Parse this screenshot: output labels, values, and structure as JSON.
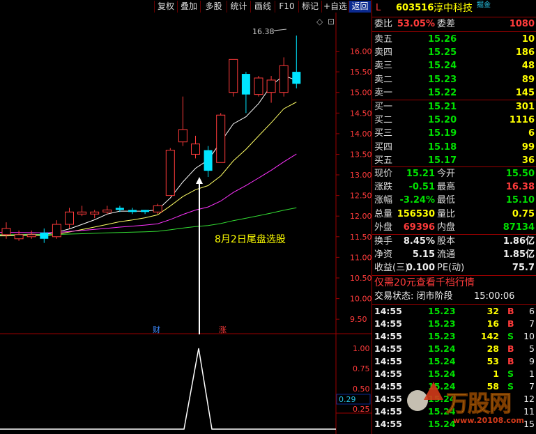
{
  "toolbar": {
    "buttons": [
      "复权",
      "叠加",
      "多股",
      "统计",
      "画线",
      "F10",
      "标记",
      "+自选",
      "返回"
    ]
  },
  "stock": {
    "flag": "L",
    "code": "603516",
    "name": "淳中科技",
    "badge": "掘金"
  },
  "order": {
    "weibi_label": "委比",
    "weibi_value": "53.05%",
    "weicha_label": "委差",
    "weicha_value": "1080",
    "asks": [
      {
        "label": "卖五",
        "price": "15.26",
        "vol": "10"
      },
      {
        "label": "卖四",
        "price": "15.25",
        "vol": "186"
      },
      {
        "label": "卖三",
        "price": "15.24",
        "vol": "48"
      },
      {
        "label": "卖二",
        "price": "15.23",
        "vol": "89"
      },
      {
        "label": "卖一",
        "price": "15.22",
        "vol": "145"
      }
    ],
    "bids": [
      {
        "label": "买一",
        "price": "15.21",
        "vol": "301"
      },
      {
        "label": "买二",
        "price": "15.20",
        "vol": "1116"
      },
      {
        "label": "买三",
        "price": "15.19",
        "vol": "6"
      },
      {
        "label": "买四",
        "price": "15.18",
        "vol": "99"
      },
      {
        "label": "买五",
        "price": "15.17",
        "vol": "36"
      }
    ]
  },
  "quote": {
    "rows": [
      {
        "l1": "现价",
        "v1": "15.21",
        "c1": "green",
        "l2": "今开",
        "v2": "15.50",
        "c2": "green"
      },
      {
        "l1": "涨跌",
        "v1": "-0.51",
        "c1": "green",
        "l2": "最高",
        "v2": "16.38",
        "c2": "red"
      },
      {
        "l1": "涨幅",
        "v1": "-3.24%",
        "c1": "green",
        "l2": "最低",
        "v2": "15.10",
        "c2": "green"
      },
      {
        "l1": "总量",
        "v1": "156530",
        "c1": "yel",
        "l2": "量比",
        "v2": "0.75",
        "c2": "yel"
      },
      {
        "l1": "外盘",
        "v1": "69396",
        "c1": "red",
        "l2": "内盘",
        "v2": "87134",
        "c2": "green"
      }
    ]
  },
  "fin": {
    "rows": [
      {
        "l1": "换手",
        "v1": "8.45%",
        "l2": "股本",
        "v2": "1.86亿"
      },
      {
        "l1": "净资",
        "v1": "5.15",
        "l2": "流通",
        "v2": "1.85亿"
      },
      {
        "l1": "收益(三)",
        "v1": "0.100",
        "l2": "PE(动)",
        "v2": "75.7"
      }
    ]
  },
  "promo": "仅需20元查看千档行情",
  "trade_status": {
    "label": "交易状态: 闭市阶段",
    "time": "15:00:06"
  },
  "ticks": [
    {
      "t": "14:55",
      "p": "15.23",
      "v": "32",
      "d": "B",
      "n": "6"
    },
    {
      "t": "14:55",
      "p": "15.23",
      "v": "16",
      "d": "B",
      "n": "7"
    },
    {
      "t": "14:55",
      "p": "15.23",
      "v": "142",
      "d": "S",
      "n": "10"
    },
    {
      "t": "14:55",
      "p": "15.24",
      "v": "28",
      "d": "B",
      "n": "5"
    },
    {
      "t": "14:55",
      "p": "15.24",
      "v": "53",
      "d": "B",
      "n": "9"
    },
    {
      "t": "14:55",
      "p": "15.24",
      "v": "1",
      "d": "S",
      "n": "1"
    },
    {
      "t": "14:55",
      "p": "15.24",
      "v": "58",
      "d": "S",
      "n": "7"
    },
    {
      "t": "14:55",
      "p": "15.24",
      "v": "",
      "d": "",
      "n": "12"
    },
    {
      "t": "14:55",
      "p": "15.24",
      "v": "",
      "d": "",
      "n": "11"
    },
    {
      "t": "14:55",
      "p": "15.24",
      "v": "",
      "d": "",
      "n": "15"
    }
  ],
  "watermark": {
    "text": "万股网",
    "url": "www.20108.com"
  },
  "chart_data": {
    "type": "candlestick",
    "price_axis_ticks": [
      "16.00",
      "15.50",
      "15.00",
      "14.50",
      "14.00",
      "13.50",
      "13.00",
      "12.50",
      "12.00",
      "11.50",
      "11.00",
      "10.50",
      "10.00",
      "9.50"
    ],
    "ylim": [
      9.3,
      16.6
    ],
    "high_label": "16.38",
    "annotation": "8月2日尾盘选股",
    "event_labels": [
      "财",
      "涨"
    ],
    "candles": [
      {
        "o": 11.55,
        "c": 11.7,
        "h": 11.85,
        "l": 11.45
      },
      {
        "o": 11.45,
        "c": 11.55,
        "h": 11.65,
        "l": 11.4
      },
      {
        "o": 11.5,
        "c": 11.55,
        "h": 11.65,
        "l": 11.45
      },
      {
        "o": 11.6,
        "c": 11.45,
        "h": 11.7,
        "l": 11.35
      },
      {
        "o": 11.5,
        "c": 11.8,
        "h": 11.9,
        "l": 11.45
      },
      {
        "o": 11.8,
        "c": 12.1,
        "h": 12.2,
        "l": 11.7
      },
      {
        "o": 12.05,
        "c": 12.1,
        "h": 12.25,
        "l": 12.0
      },
      {
        "o": 12.05,
        "c": 12.1,
        "h": 12.15,
        "l": 11.95
      },
      {
        "o": 12.1,
        "c": 12.15,
        "h": 12.25,
        "l": 12.05
      },
      {
        "o": 12.2,
        "c": 12.15,
        "h": 12.25,
        "l": 12.1
      },
      {
        "o": 12.15,
        "c": 12.1,
        "h": 12.2,
        "l": 12.05
      },
      {
        "o": 12.15,
        "c": 12.1,
        "h": 12.15,
        "l": 12.05
      },
      {
        "o": 12.1,
        "c": 12.25,
        "h": 12.3,
        "l": 12.05
      },
      {
        "o": 12.5,
        "c": 13.6,
        "h": 13.65,
        "l": 12.5
      },
      {
        "o": 13.8,
        "c": 14.1,
        "h": 14.9,
        "l": 13.7
      },
      {
        "o": 13.5,
        "c": 13.75,
        "h": 13.95,
        "l": 13.4
      },
      {
        "o": 13.6,
        "c": 13.1,
        "h": 13.7,
        "l": 12.95
      },
      {
        "o": 13.3,
        "c": 14.45,
        "h": 14.5,
        "l": 13.3
      },
      {
        "o": 15.0,
        "c": 15.8,
        "h": 15.8,
        "l": 14.9
      },
      {
        "o": 15.45,
        "c": 14.95,
        "h": 15.5,
        "l": 14.5
      },
      {
        "o": 14.95,
        "c": 15.35,
        "h": 15.4,
        "l": 14.9
      },
      {
        "o": 15.0,
        "c": 15.3,
        "h": 15.4,
        "l": 14.75
      },
      {
        "o": 15.0,
        "c": 15.65,
        "h": 15.85,
        "l": 14.9
      },
      {
        "o": 15.5,
        "c": 15.21,
        "h": 16.38,
        "l": 15.1
      }
    ],
    "indicator_ticks": [
      "1.00",
      "0.75",
      "0.50",
      "0.25"
    ],
    "indicator_value": "0.29"
  }
}
